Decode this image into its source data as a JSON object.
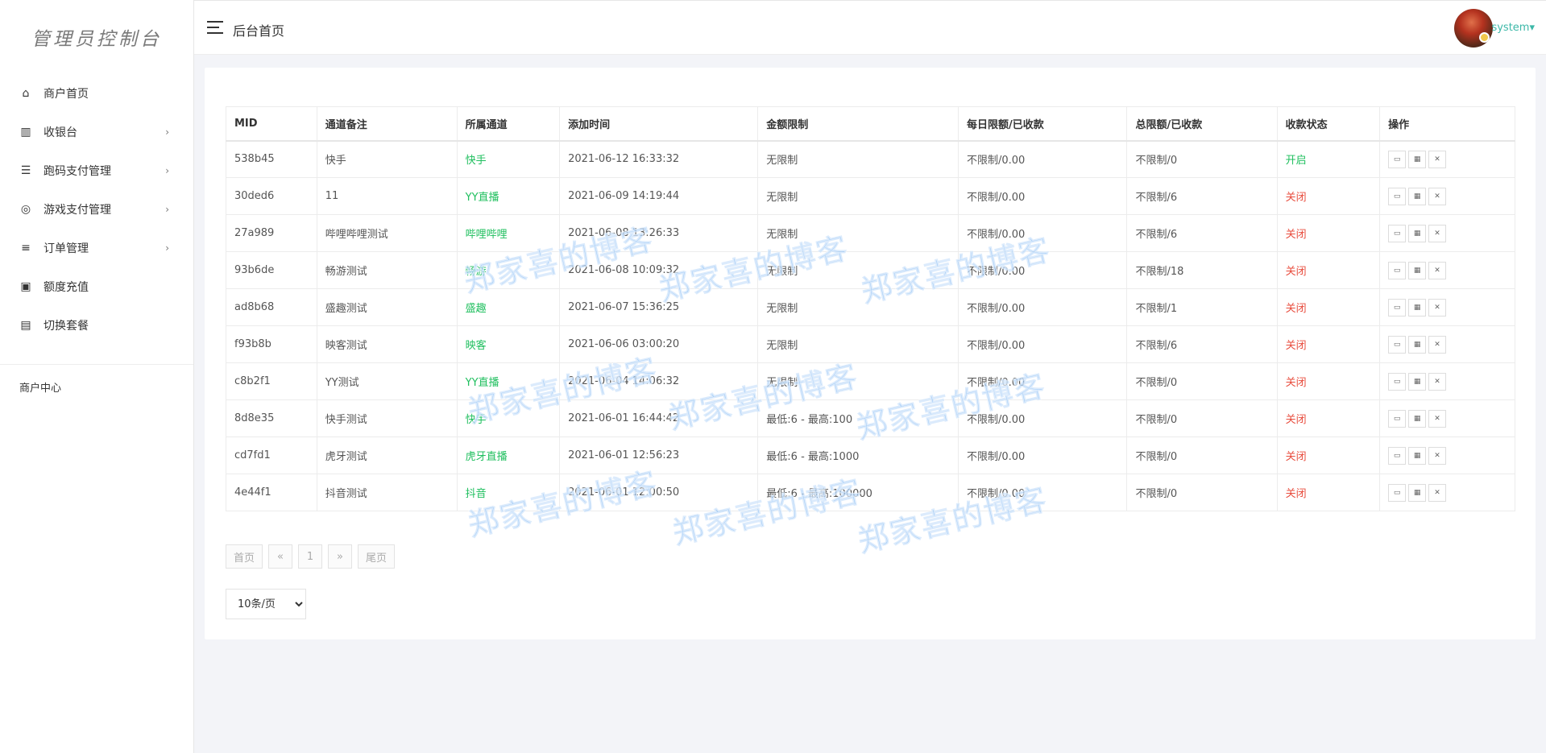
{
  "sidebar": {
    "logo": "管理员控制台",
    "items": [
      {
        "label": "商户首页",
        "icon": "home-icon",
        "arrow": false
      },
      {
        "label": "收银台",
        "icon": "bank-icon",
        "arrow": true
      },
      {
        "label": "跑码支付管理",
        "icon": "list-icon",
        "arrow": true
      },
      {
        "label": "游戏支付管理",
        "icon": "gamepad-icon",
        "arrow": true
      },
      {
        "label": "订单管理",
        "icon": "bars-icon",
        "arrow": true
      },
      {
        "label": "额度充值",
        "icon": "money-icon",
        "arrow": false
      },
      {
        "label": "切换套餐",
        "icon": "bag-icon",
        "arrow": false
      }
    ],
    "section": "商户中心"
  },
  "header": {
    "title": "后台首页",
    "user": "system"
  },
  "table": {
    "columns": [
      "MID",
      "通道备注",
      "所属通道",
      "添加时间",
      "金额限制",
      "每日限额/已收款",
      "总限额/已收款",
      "收款状态",
      "操作"
    ],
    "rows": [
      [
        "538b45",
        "快手",
        "快手",
        "2021-06-12 16:33:32",
        "无限制",
        "不限制/0.00",
        "不限制/0",
        "开启"
      ],
      [
        "30ded6",
        "11",
        "YY直播",
        "2021-06-09 14:19:44",
        "无限制",
        "不限制/0.00",
        "不限制/6",
        "关闭"
      ],
      [
        "27a989",
        "哔哩哔哩测试",
        "哔哩哔哩",
        "2021-06-08 13:26:33",
        "无限制",
        "不限制/0.00",
        "不限制/6",
        "关闭"
      ],
      [
        "93b6de",
        "畅游测试",
        "畅游",
        "2021-06-08 10:09:32",
        "无限制",
        "不限制/0.00",
        "不限制/18",
        "关闭"
      ],
      [
        "ad8b68",
        "盛趣测试",
        "盛趣",
        "2021-06-07 15:36:25",
        "无限制",
        "不限制/0.00",
        "不限制/1",
        "关闭"
      ],
      [
        "f93b8b",
        "映客测试",
        "映客",
        "2021-06-06 03:00:20",
        "无限制",
        "不限制/0.00",
        "不限制/6",
        "关闭"
      ],
      [
        "c8b2f1",
        "YY测试",
        "YY直播",
        "2021-06-04 14:06:32",
        "无限制",
        "不限制/0.00",
        "不限制/0",
        "关闭"
      ],
      [
        "8d8e35",
        "快手测试",
        "快手",
        "2021-06-01 16:44:42",
        "最低:6 - 最高:100",
        "不限制/0.00",
        "不限制/0",
        "关闭"
      ],
      [
        "cd7fd1",
        "虎牙测试",
        "虎牙直播",
        "2021-06-01 12:56:23",
        "最低:6 - 最高:1000",
        "不限制/0.00",
        "不限制/0",
        "关闭"
      ],
      [
        "4e44f1",
        "抖音测试",
        "抖音",
        "2021-06-01 12:00:50",
        "最低:6 - 最高:100000",
        "不限制/0.00",
        "不限制/0",
        "关闭"
      ]
    ],
    "status_on": "开启"
  },
  "pagination": {
    "first": "首页",
    "prev": "«",
    "current": "1",
    "next": "»",
    "last": "尾页",
    "page_size": "10条/页"
  },
  "watermark": "郑家喜的博客",
  "colors": {
    "channel": "#1fbf5e",
    "status_on": "#1fbf5e",
    "status_off": "#e84c3d",
    "user": "#3cb8a8"
  }
}
